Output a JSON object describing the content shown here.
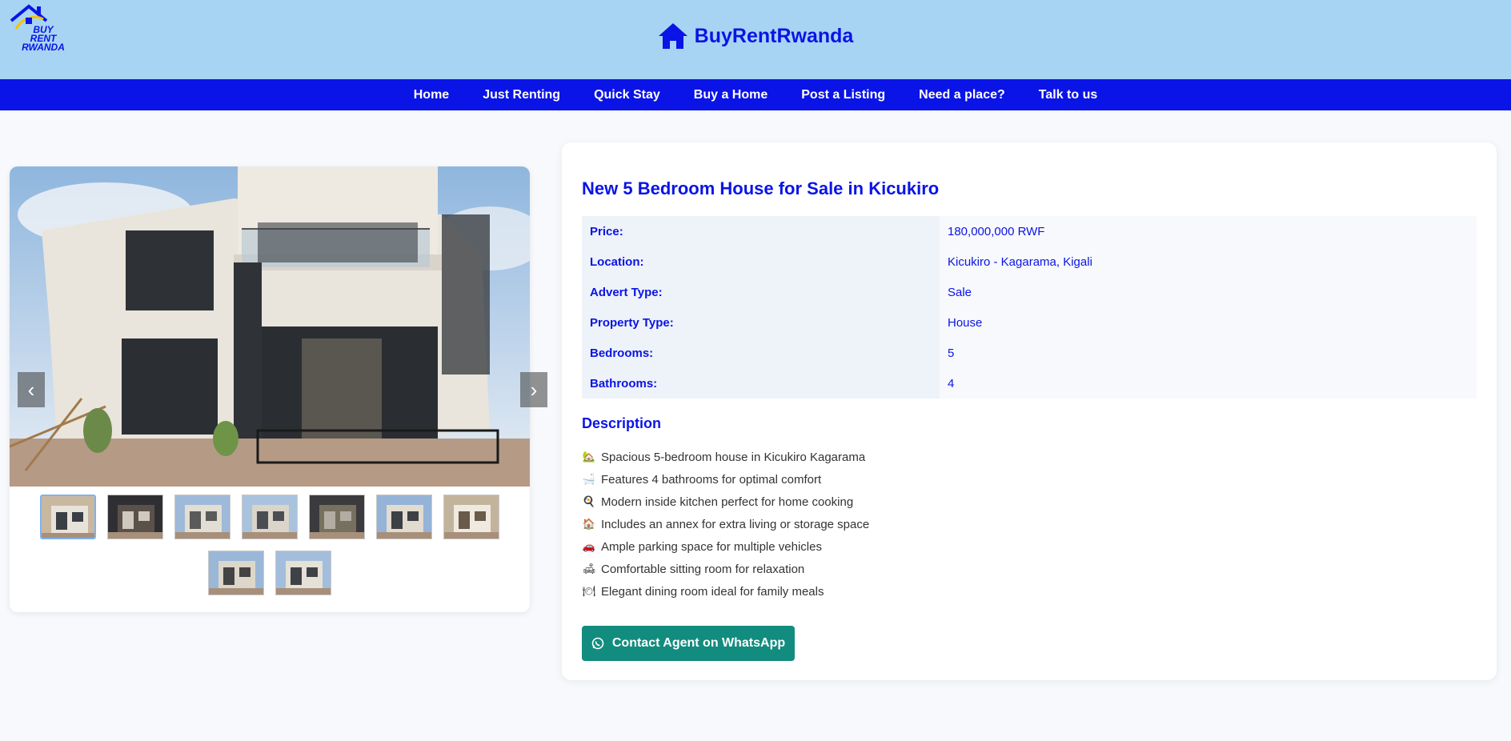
{
  "header": {
    "logo_text": "BUY\nRENT\nRWANDA",
    "brand_title": "BuyRentRwanda",
    "brand_icon": "home-icon",
    "accent": "#0a14e6",
    "bg": "#a8d4f3"
  },
  "nav": {
    "items": [
      "Home",
      "Just Renting",
      "Quick Stay",
      "Buy a Home",
      "Post a Listing",
      "Need a place?",
      "Talk to us"
    ]
  },
  "gallery": {
    "prev": "‹",
    "next": "›",
    "thumbnail_count": 9,
    "active_index": 0
  },
  "listing": {
    "title": "New 5 Bedroom House for Sale in Kicukiro",
    "rows": [
      {
        "label": "Price:",
        "value": "180,000,000 RWF"
      },
      {
        "label": "Location:",
        "value": "Kicukiro - Kagarama, Kigali"
      },
      {
        "label": "Advert Type:",
        "value": "Sale"
      },
      {
        "label": "Property Type:",
        "value": "House"
      },
      {
        "label": "Bedrooms:",
        "value": "5"
      },
      {
        "label": "Bathrooms:",
        "value": "4"
      }
    ],
    "description_heading": "Description",
    "description": [
      {
        "icon": "🏡",
        "text": "Spacious 5-bedroom house in Kicukiro Kagarama"
      },
      {
        "icon": "🛁",
        "text": "Features 4 bathrooms for optimal comfort"
      },
      {
        "icon": "🍳",
        "text": "Modern inside kitchen perfect for home cooking"
      },
      {
        "icon": "🏠",
        "text": "Includes an annex for extra living or storage space"
      },
      {
        "icon": "🚗",
        "text": "Ample parking space for multiple vehicles"
      },
      {
        "icon": "🛋",
        "text": "Comfortable sitting room for relaxation"
      },
      {
        "icon": "🍽",
        "text": "Elegant dining room ideal for family meals"
      }
    ],
    "whatsapp_button": "Contact Agent on WhatsApp",
    "whatsapp_color": "#128c7e"
  }
}
